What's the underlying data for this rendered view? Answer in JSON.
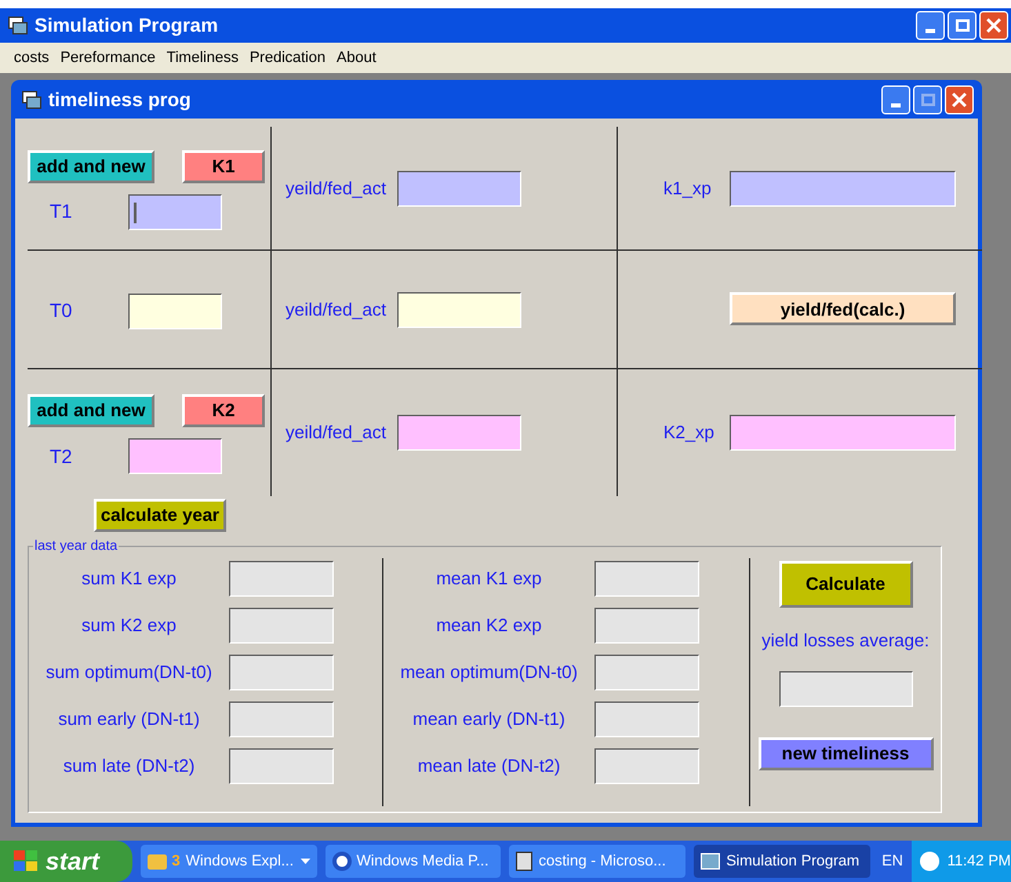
{
  "window": {
    "title": "Simulation Program"
  },
  "menu": [
    "costs",
    "Pereformance",
    "Timeliness",
    "Predication",
    "About"
  ],
  "child_window": {
    "title": "timeliness prog"
  },
  "rows": [
    {
      "buttons": [
        {
          "label": "add and new",
          "kind": "add"
        },
        {
          "label": "K1",
          "kind": "k"
        }
      ],
      "t_field": {
        "label": "T1",
        "color": "#c0c0ff",
        "focused": true
      },
      "yield_field": {
        "label": "yeild/fed_act",
        "color": "#c0c0ff"
      },
      "right": {
        "kind": "field",
        "label": "k1_xp",
        "color": "#c0c0ff"
      }
    },
    {
      "t_field": {
        "label": "T0",
        "color": "#ffffe0",
        "focused": false
      },
      "yield_field": {
        "label": "yeild/fed_act",
        "color": "#ffffe0"
      },
      "right": {
        "kind": "button",
        "label": "yield/fed(calc.)"
      }
    },
    {
      "buttons": [
        {
          "label": "add and new",
          "kind": "add"
        },
        {
          "label": "K2",
          "kind": "k"
        }
      ],
      "t_field": {
        "label": "T2",
        "color": "#ffc0ff",
        "focused": false
      },
      "yield_field": {
        "label": "yeild/fed_act",
        "color": "#ffc0ff"
      },
      "right": {
        "kind": "field",
        "label": "K2_xp",
        "color": "#ffc0ff"
      }
    }
  ],
  "calculate_year_button": "calculate year",
  "last_year": {
    "title": "last year data",
    "sum": [
      "sum K1 exp",
      "sum K2 exp",
      "sum optimum(DN-t0)",
      "sum early (DN-t1)",
      "sum late (DN-t2)"
    ],
    "mean": [
      "mean K1 exp",
      "mean K2 exp",
      "mean optimum(DN-t0)",
      "mean early (DN-t1)",
      "mean late (DN-t2)"
    ],
    "calculate_button": "Calculate",
    "average_label": "yield losses average:",
    "new_button": "new timeliness"
  },
  "taskbar": {
    "start": "start",
    "tasks": [
      {
        "count": "3",
        "label": "Windows Expl...",
        "kind": "group",
        "selected": false
      },
      {
        "label": "Windows Media P...",
        "kind": "media",
        "selected": false
      },
      {
        "label": "costing - Microso...",
        "kind": "doc",
        "selected": false
      },
      {
        "label": "Simulation Program",
        "kind": "app",
        "selected": true
      }
    ],
    "language": "EN",
    "clock": "11:42 PM"
  }
}
